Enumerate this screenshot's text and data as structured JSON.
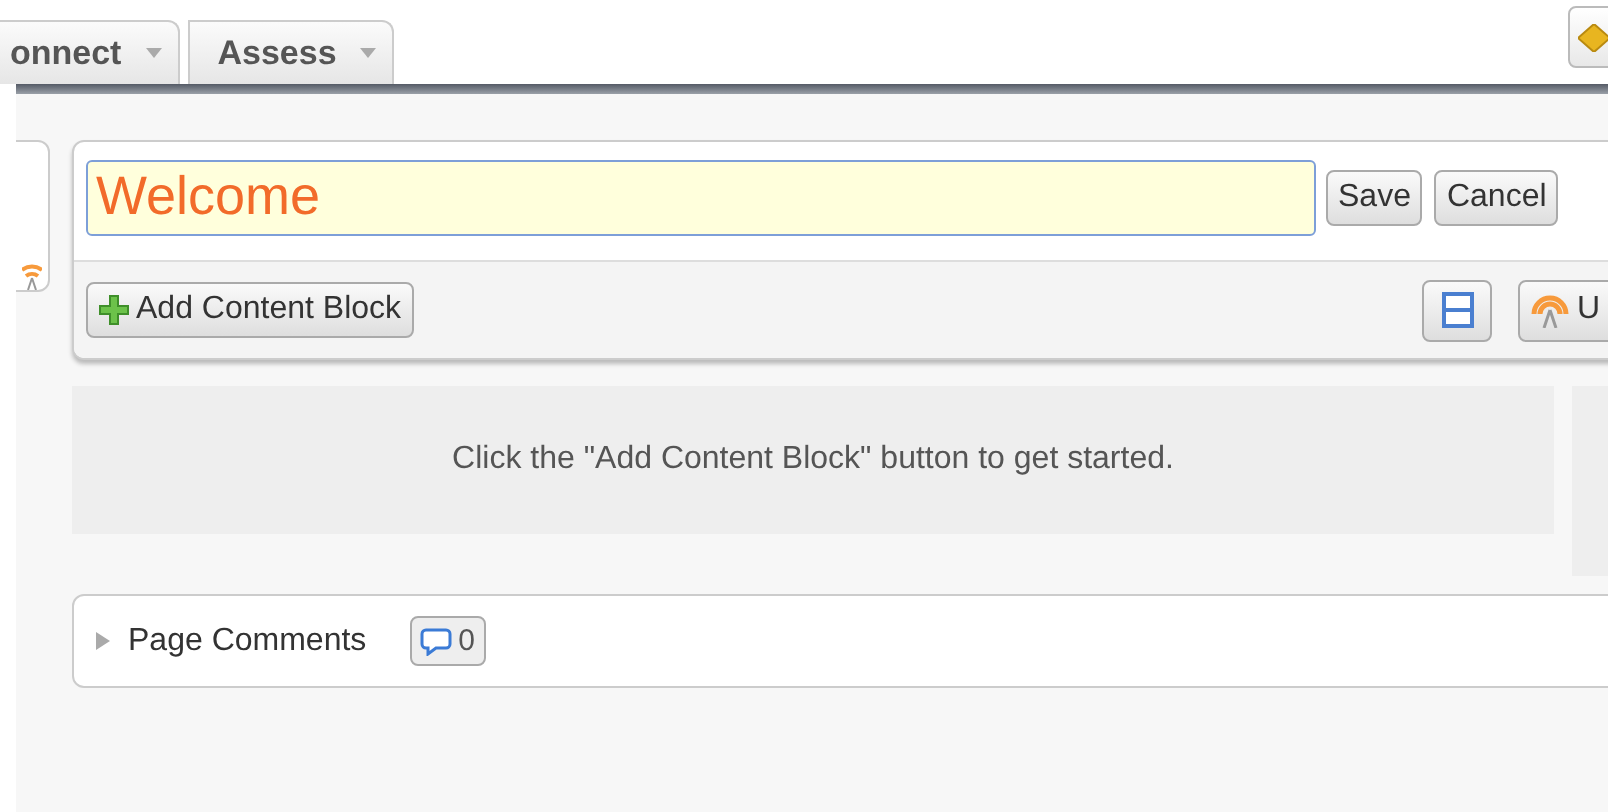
{
  "tabs": [
    {
      "label": "onnect",
      "selected": false
    },
    {
      "label": "Assess",
      "selected": false
    }
  ],
  "title_field": {
    "value": "Welcome"
  },
  "title_buttons": [
    "Save",
    "Cancel"
  ],
  "toolbar": {
    "add_button": "Add Content Block",
    "cut_button": "U"
  },
  "empty_message": "Click the \"Add Content Block\" button to get started.",
  "comments": {
    "label": "Page Comments",
    "count": "0",
    "expanded": false
  }
}
